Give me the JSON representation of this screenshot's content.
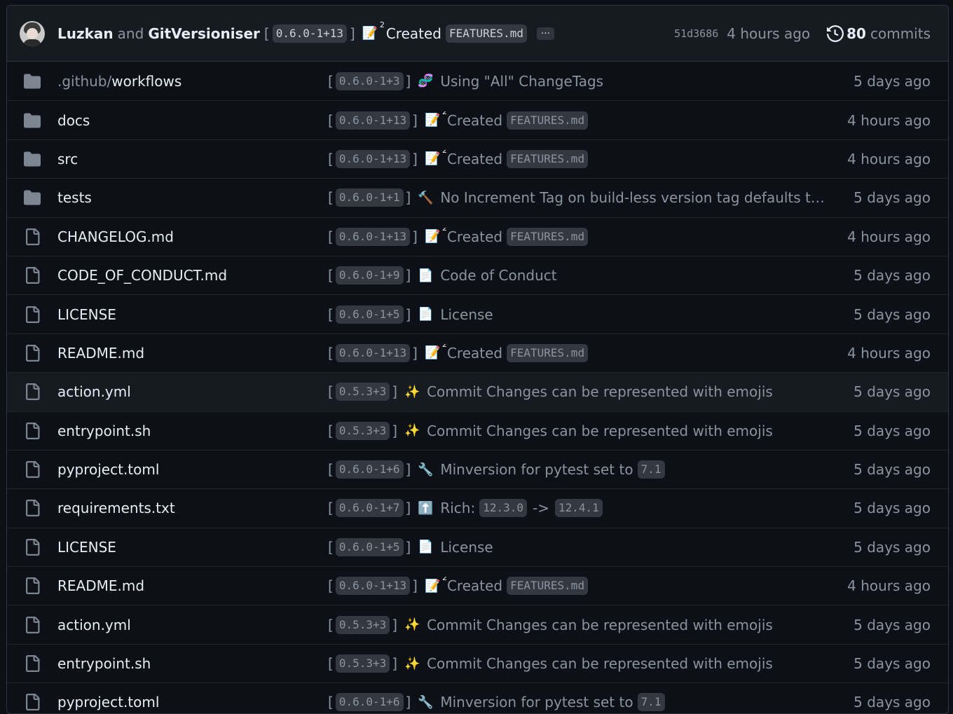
{
  "header": {
    "author1": "Luzkan",
    "and_text": "and",
    "author2": "GitVersioniser",
    "open_bracket": "[",
    "version": "0.6.0-1+13",
    "close_bracket": "]",
    "emoji_icon": "memo-icon",
    "emoji_glyph": "📝",
    "emoji_sup": "2",
    "commit_text": "Created",
    "commit_code": "FEATURES.md",
    "more_label": "…",
    "sha": "51d3686",
    "time": "4 hours ago",
    "commits_count": "80",
    "commits_label": "commits"
  },
  "rows": [
    {
      "type": "dir",
      "name_prefix": ".github/",
      "name": "workflows",
      "version": "0.6.0-1+3",
      "emoji": "🧬",
      "sup": "",
      "text": "Using \"All\" ChangeTags",
      "time": "5 days ago"
    },
    {
      "type": "dir",
      "name": "docs",
      "version": "0.6.0-1+13",
      "emoji": "📝",
      "sup": "2",
      "text": "Created",
      "code": "FEATURES.md",
      "time": "4 hours ago"
    },
    {
      "type": "dir",
      "name": "src",
      "version": "0.6.0-1+13",
      "emoji": "📝",
      "sup": "2",
      "text": "Created",
      "code": "FEATURES.md",
      "time": "4 hours ago"
    },
    {
      "type": "dir",
      "name": "tests",
      "version": "0.6.0-1+1",
      "emoji": "🔨",
      "sup": "",
      "text": "No Increment Tag on build-less version tag defaults t…",
      "time": "5 days ago"
    },
    {
      "type": "file",
      "name": "CHANGELOG.md",
      "version": "0.6.0-1+13",
      "emoji": "📝",
      "sup": "2",
      "text": "Created",
      "code": "FEATURES.md",
      "time": "4 hours ago"
    },
    {
      "type": "file",
      "name": "CODE_OF_CONDUCT.md",
      "version": "0.6.0-1+9",
      "emoji": "📄",
      "sup": "",
      "text": "Code of Conduct",
      "time": "5 days ago"
    },
    {
      "type": "file",
      "name": "LICENSE",
      "version": "0.6.0-1+5",
      "emoji": "📄",
      "sup": "",
      "text": "License",
      "time": "5 days ago"
    },
    {
      "type": "file",
      "name": "README.md",
      "version": "0.6.0-1+13",
      "emoji": "📝",
      "sup": "2",
      "text": "Created",
      "code": "FEATURES.md",
      "time": "4 hours ago"
    },
    {
      "type": "file",
      "name": "action.yml",
      "version": "0.5.3+3",
      "emoji": "✨",
      "sup": "",
      "text": "Commit Changes can be represented with emojis",
      "time": "5 days ago",
      "highlight": true
    },
    {
      "type": "file",
      "name": "entrypoint.sh",
      "version": "0.5.3+3",
      "emoji": "✨",
      "sup": "",
      "text": "Commit Changes can be represented with emojis",
      "time": "5 days ago"
    },
    {
      "type": "file",
      "name": "pyproject.toml",
      "version": "0.6.0-1+6",
      "emoji": "🔧",
      "sup": "",
      "text": "Minversion for pytest set to",
      "code": "7.1",
      "time": "5 days ago"
    },
    {
      "type": "file",
      "name": "requirements.txt",
      "version": "0.6.0-1+7",
      "emoji": "⬆️",
      "sup": "",
      "text": "Rich:",
      "code": "12.3.0",
      "arrow": "->",
      "code2": "12.4.1",
      "time": "5 days ago"
    },
    {
      "type": "file",
      "name": "LICENSE",
      "version": "0.6.0-1+5",
      "emoji": "📄",
      "sup": "",
      "text": "License",
      "time": "5 days ago"
    },
    {
      "type": "file",
      "name": "README.md",
      "version": "0.6.0-1+13",
      "emoji": "📝",
      "sup": "2",
      "text": "Created",
      "code": "FEATURES.md",
      "time": "4 hours ago"
    },
    {
      "type": "file",
      "name": "action.yml",
      "version": "0.5.3+3",
      "emoji": "✨",
      "sup": "",
      "text": "Commit Changes can be represented with emojis",
      "time": "5 days ago"
    },
    {
      "type": "file",
      "name": "entrypoint.sh",
      "version": "0.5.3+3",
      "emoji": "✨",
      "sup": "",
      "text": "Commit Changes can be represented with emojis",
      "time": "5 days ago"
    },
    {
      "type": "file",
      "name": "pyproject.toml",
      "version": "0.6.0-1+6",
      "emoji": "🔧",
      "sup": "",
      "text": "Minversion for pytest set to",
      "code": "7.1",
      "time": "5 days ago"
    }
  ],
  "colors": {
    "background": "#0d1117",
    "header": "#161b22",
    "border": "#30363d",
    "muted": "#8b949e",
    "text": "#e6edf3"
  }
}
